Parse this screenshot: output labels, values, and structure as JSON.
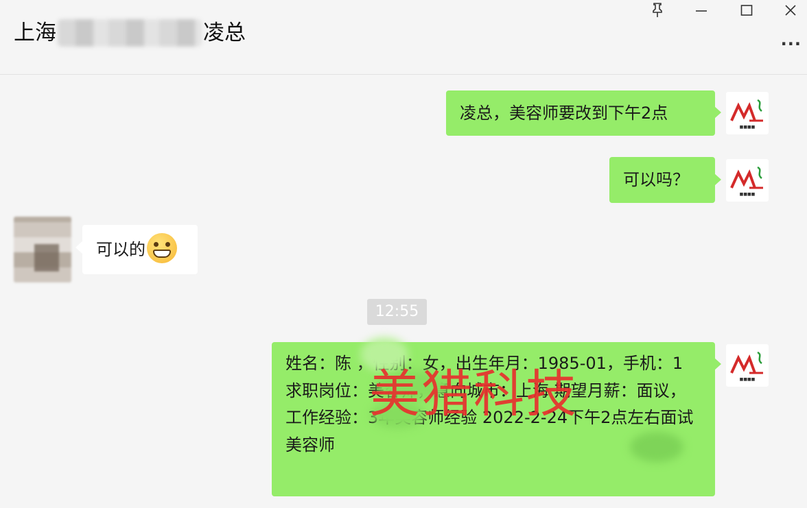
{
  "window": {
    "title_prefix": "上海",
    "title_suffix": "凌总",
    "controls": {
      "pin": "⚲",
      "minimize": "—",
      "maximize": "☐",
      "close": "✕"
    },
    "more": "···"
  },
  "messages": [
    {
      "side": "right",
      "text": "凌总，美容师要改到下午2点"
    },
    {
      "side": "right",
      "text": "可以吗？"
    },
    {
      "side": "left",
      "text": "可以的"
    },
    {
      "side": "right",
      "text": "姓名：陈 ，性别：女，出生年月：1985-01，手机：1 求职岗位：美容师，意向城市：上海 期望月薪：面议，工作经验：3年美容师经验 2022-2-24下午2点左右面试 美容师"
    }
  ],
  "timestamp": "12:55",
  "watermark": "美猎科技",
  "brand_avatar": {
    "logo_color": "#d42a2a",
    "accent_color": "#2a9d3a"
  },
  "colors": {
    "bubble_self": "#95ec69",
    "bubble_other": "#ffffff",
    "background": "#f5f5f5"
  }
}
